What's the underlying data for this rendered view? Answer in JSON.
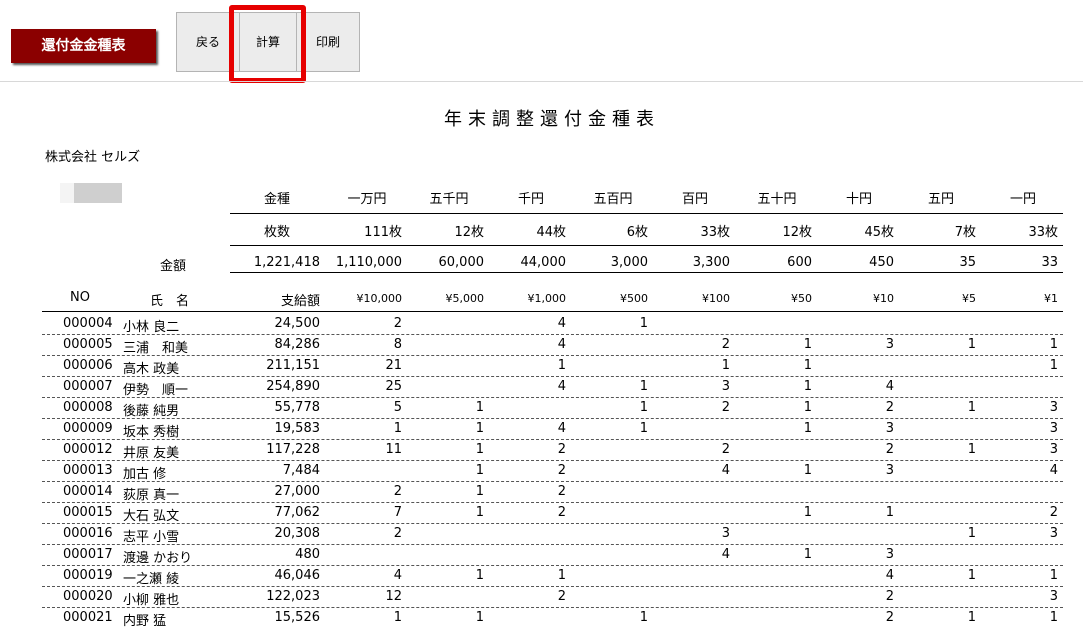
{
  "toolbar": {
    "sheet_title": "還付金金種表",
    "back_label": "戻る",
    "calc_label": "計算",
    "print_label": "印刷"
  },
  "report": {
    "title": "年末調整還付金種表",
    "company": "株式会社 セルズ"
  },
  "summary": {
    "denom_label": "金種",
    "count_label": "枚数",
    "amount_label": "金額",
    "total_amount": "1,221,418",
    "denominations": [
      {
        "name": "一万円",
        "count": "111枚",
        "amount": "1,110,000"
      },
      {
        "name": "五千円",
        "count": "12枚",
        "amount": "60,000"
      },
      {
        "name": "千円",
        "count": "44枚",
        "amount": "44,000"
      },
      {
        "name": "五百円",
        "count": "6枚",
        "amount": "3,000"
      },
      {
        "name": "百円",
        "count": "33枚",
        "amount": "3,300"
      },
      {
        "name": "五十円",
        "count": "12枚",
        "amount": "600"
      },
      {
        "name": "十円",
        "count": "45枚",
        "amount": "450"
      },
      {
        "name": "五円",
        "count": "7枚",
        "amount": "35"
      },
      {
        "name": "一円",
        "count": "33枚",
        "amount": "33"
      }
    ]
  },
  "table": {
    "col_no": "NO",
    "col_name": "氏　名",
    "col_amount": "支給額",
    "denom_headers": [
      "¥10,000",
      "¥5,000",
      "¥1,000",
      "¥500",
      "¥100",
      "¥50",
      "¥10",
      "¥5",
      "¥1"
    ],
    "rows": [
      {
        "no": "000004",
        "name": "小林 良二",
        "amount": "24,500",
        "counts": [
          "2",
          "",
          "4",
          "1",
          "",
          "",
          "",
          "",
          ""
        ]
      },
      {
        "no": "000005",
        "name": "三浦　和美",
        "amount": "84,286",
        "counts": [
          "8",
          "",
          "4",
          "",
          "2",
          "1",
          "3",
          "1",
          "1"
        ]
      },
      {
        "no": "000006",
        "name": "高木 政美",
        "amount": "211,151",
        "counts": [
          "21",
          "",
          "1",
          "",
          "1",
          "1",
          "",
          "",
          "1"
        ]
      },
      {
        "no": "000007",
        "name": "伊勢　順一",
        "amount": "254,890",
        "counts": [
          "25",
          "",
          "4",
          "1",
          "3",
          "1",
          "4",
          "",
          ""
        ]
      },
      {
        "no": "000008",
        "name": "後藤 純男",
        "amount": "55,778",
        "counts": [
          "5",
          "1",
          "",
          "1",
          "2",
          "1",
          "2",
          "1",
          "3"
        ]
      },
      {
        "no": "000009",
        "name": "坂本 秀樹",
        "amount": "19,583",
        "counts": [
          "1",
          "1",
          "4",
          "1",
          "",
          "1",
          "3",
          "",
          "3"
        ]
      },
      {
        "no": "000012",
        "name": "井原 友美",
        "amount": "117,228",
        "counts": [
          "11",
          "1",
          "2",
          "",
          "2",
          "",
          "2",
          "1",
          "3"
        ]
      },
      {
        "no": "000013",
        "name": "加古 修",
        "amount": "7,484",
        "counts": [
          "",
          "1",
          "2",
          "",
          "4",
          "1",
          "3",
          "",
          "4"
        ]
      },
      {
        "no": "000014",
        "name": "荻原 真一",
        "amount": "27,000",
        "counts": [
          "2",
          "1",
          "2",
          "",
          "",
          "",
          "",
          "",
          ""
        ]
      },
      {
        "no": "000015",
        "name": "大石 弘文",
        "amount": "77,062",
        "counts": [
          "7",
          "1",
          "2",
          "",
          "",
          "1",
          "1",
          "",
          "2"
        ]
      },
      {
        "no": "000016",
        "name": "志平 小雪",
        "amount": "20,308",
        "counts": [
          "2",
          "",
          "",
          "",
          "3",
          "",
          "",
          "1",
          "3"
        ]
      },
      {
        "no": "000017",
        "name": "渡邊 かおり",
        "amount": "480",
        "counts": [
          "",
          "",
          "",
          "",
          "4",
          "1",
          "3",
          "",
          ""
        ]
      },
      {
        "no": "000019",
        "name": "一之瀬 綾",
        "amount": "46,046",
        "counts": [
          "4",
          "1",
          "1",
          "",
          "",
          "",
          "4",
          "1",
          "1"
        ]
      },
      {
        "no": "000020",
        "name": "小柳 雅也",
        "amount": "122,023",
        "counts": [
          "12",
          "",
          "2",
          "",
          "",
          "",
          "2",
          "",
          "3"
        ]
      },
      {
        "no": "000021",
        "name": "内野 猛",
        "amount": "15,526",
        "counts": [
          "1",
          "1",
          "",
          "1",
          "",
          "",
          "2",
          "1",
          "1"
        ]
      }
    ]
  }
}
